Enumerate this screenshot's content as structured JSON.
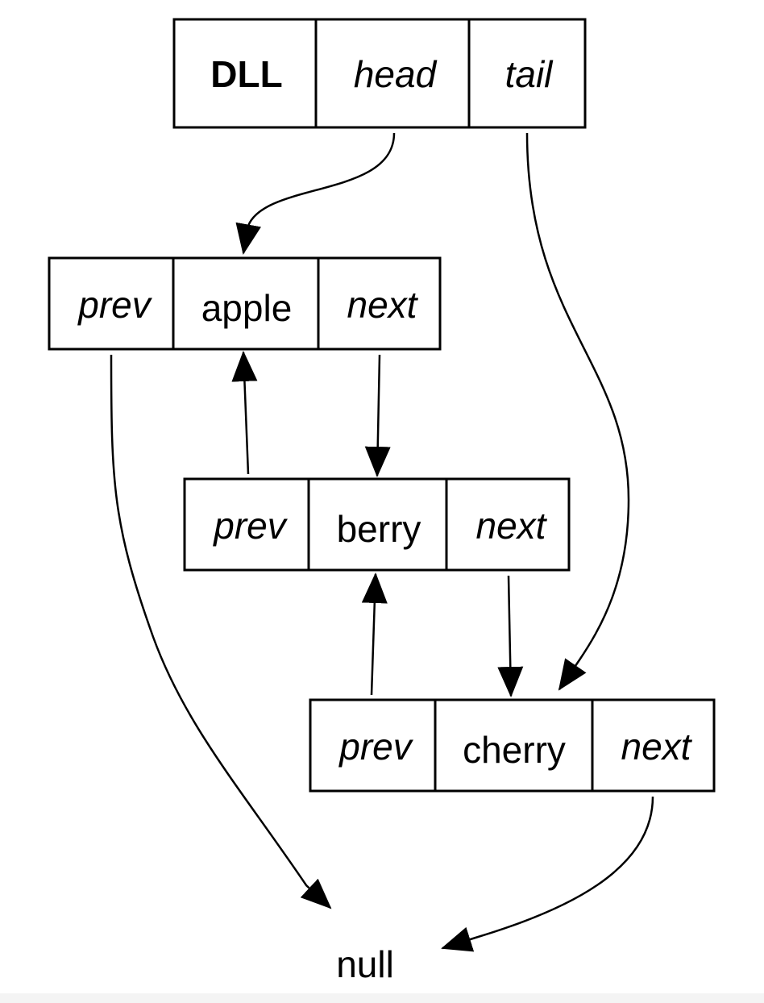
{
  "list": {
    "label": "DLL",
    "head_field": "head",
    "tail_field": "tail"
  },
  "nodes": [
    {
      "prev": "prev",
      "value": "apple",
      "next": "next"
    },
    {
      "prev": "prev",
      "value": "berry",
      "next": "next"
    },
    {
      "prev": "prev",
      "value": "cherry",
      "next": "next"
    }
  ],
  "terminal": "null",
  "edges": [
    {
      "from": "DLL.head",
      "to": "apple"
    },
    {
      "from": "DLL.tail",
      "to": "cherry"
    },
    {
      "from": "apple.prev",
      "to": "null"
    },
    {
      "from": "apple.next",
      "to": "berry"
    },
    {
      "from": "berry.prev",
      "to": "apple"
    },
    {
      "from": "berry.next",
      "to": "cherry"
    },
    {
      "from": "cherry.prev",
      "to": "berry"
    },
    {
      "from": "cherry.next",
      "to": "null"
    }
  ]
}
